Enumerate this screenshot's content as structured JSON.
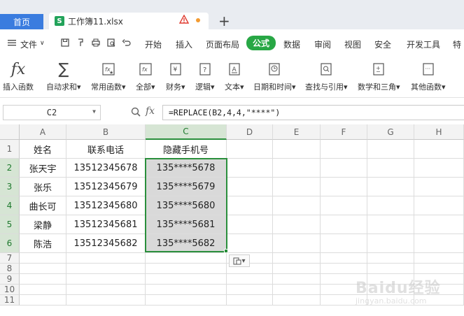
{
  "tabs": {
    "home_label": "首页",
    "file_label": "工作簿11.xlsx",
    "new_tab": "+"
  },
  "menu": {
    "file_label": "文件",
    "items": [
      "开始",
      "插入",
      "页面布局",
      "公式",
      "数据",
      "审阅",
      "视图",
      "安全",
      "开发工具",
      "特"
    ],
    "active": "公式"
  },
  "ribbon": {
    "items": [
      {
        "label": "插入函数",
        "icon": "fx-icon"
      },
      {
        "label": "自动求和",
        "icon": "sigma-icon",
        "dropdown": true
      },
      {
        "label": "常用函数",
        "icon": "star-function-icon",
        "dropdown": true
      },
      {
        "label": "全部",
        "icon": "all-functions-icon",
        "dropdown": true
      },
      {
        "label": "财务",
        "icon": "yen-icon",
        "dropdown": true
      },
      {
        "label": "逻辑",
        "icon": "question-icon",
        "dropdown": true
      },
      {
        "label": "文本",
        "icon": "text-a-icon",
        "dropdown": true
      },
      {
        "label": "日期和时间",
        "icon": "clock-icon",
        "dropdown": true
      },
      {
        "label": "查找与引用",
        "icon": "search-doc-icon",
        "dropdown": true
      },
      {
        "label": "数学和三角",
        "icon": "plus-minus-icon",
        "dropdown": true
      },
      {
        "label": "其他函数",
        "icon": "more-doc-icon",
        "dropdown": true
      }
    ],
    "dropdown_glyph": "▾"
  },
  "formula_bar": {
    "cell_ref": "C2",
    "fx_label": "fx",
    "formula": "=REPLACE(B2,4,4,\"****\")"
  },
  "sheet": {
    "columns": [
      "A",
      "B",
      "C",
      "D",
      "E",
      "F",
      "G",
      "H"
    ],
    "selected_column": "C",
    "rows": [
      {
        "num": "1",
        "cells": [
          "姓名",
          "联系电话",
          "隐藏手机号"
        ]
      },
      {
        "num": "2",
        "cells": [
          "张天宇",
          "13512345678",
          "135****5678"
        ]
      },
      {
        "num": "3",
        "cells": [
          "张乐",
          "13512345679",
          "135****5679"
        ]
      },
      {
        "num": "4",
        "cells": [
          "曲长可",
          "13512345680",
          "135****5680"
        ]
      },
      {
        "num": "5",
        "cells": [
          "梁静",
          "13512345681",
          "135****5681"
        ]
      },
      {
        "num": "6",
        "cells": [
          "陈浩",
          "13512345682",
          "135****5682"
        ]
      },
      {
        "num": "7",
        "cells": [
          "",
          "",
          ""
        ]
      },
      {
        "num": "8",
        "cells": [
          "",
          "",
          ""
        ]
      },
      {
        "num": "9",
        "cells": [
          "",
          "",
          ""
        ]
      },
      {
        "num": "10",
        "cells": [
          "",
          "",
          ""
        ]
      },
      {
        "num": "11",
        "cells": [
          "",
          "",
          ""
        ]
      }
    ],
    "selected_rows": [
      "2",
      "3",
      "4",
      "5",
      "6"
    ]
  },
  "paste_options": {
    "icon": "paste-options-icon",
    "glyph": "▾"
  },
  "watermark": {
    "text": "Baidu经验",
    "sub": "jingyan.baidu.com"
  },
  "colors": {
    "accent_green": "#2a8f3c",
    "tab_blue": "#3a7cdf",
    "selected_gray": "#d9d9d9"
  }
}
